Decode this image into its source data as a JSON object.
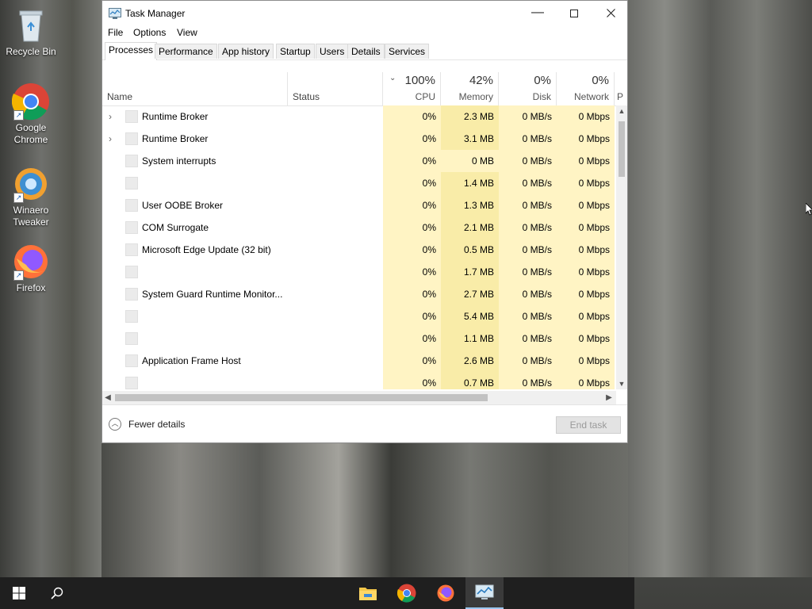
{
  "desktop": {
    "icons": [
      {
        "label": "Recycle Bin",
        "icon": "recycle-bin-icon"
      },
      {
        "label": "Google Chrome",
        "icon": "chrome-icon"
      },
      {
        "label": "Winaero Tweaker",
        "icon": "winaero-tweaker-icon"
      },
      {
        "label": "Firefox",
        "icon": "firefox-icon"
      }
    ]
  },
  "window": {
    "title": "Task Manager",
    "menu": [
      "File",
      "Options",
      "View"
    ],
    "tabs": [
      "Processes",
      "Performance",
      "App history",
      "Startup",
      "Users",
      "Details",
      "Services"
    ],
    "active_tab": "Processes",
    "columns": {
      "name": "Name",
      "status": "Status",
      "cpu": {
        "pct": "100%",
        "label": "CPU"
      },
      "memory": {
        "pct": "42%",
        "label": "Memory"
      },
      "disk": {
        "pct": "0%",
        "label": "Disk"
      },
      "network": {
        "pct": "0%",
        "label": "Network"
      },
      "power_partial": "P"
    },
    "rows": [
      {
        "name": "Runtime Broker",
        "expandable": true,
        "cpu": "0%",
        "memory": "2.3 MB",
        "disk": "0 MB/s",
        "network": "0 Mbps"
      },
      {
        "name": "Runtime Broker",
        "expandable": true,
        "cpu": "0%",
        "memory": "3.1 MB",
        "disk": "0 MB/s",
        "network": "0 Mbps"
      },
      {
        "name": "System interrupts",
        "expandable": false,
        "cpu": "0%",
        "memory": "0 MB",
        "disk": "0 MB/s",
        "network": "0 Mbps"
      },
      {
        "name": "",
        "expandable": false,
        "cpu": "0%",
        "memory": "1.4 MB",
        "disk": "0 MB/s",
        "network": "0 Mbps"
      },
      {
        "name": "User OOBE Broker",
        "expandable": false,
        "cpu": "0%",
        "memory": "1.3 MB",
        "disk": "0 MB/s",
        "network": "0 Mbps"
      },
      {
        "name": "COM Surrogate",
        "expandable": false,
        "cpu": "0%",
        "memory": "2.1 MB",
        "disk": "0 MB/s",
        "network": "0 Mbps"
      },
      {
        "name": "Microsoft Edge Update (32 bit)",
        "expandable": false,
        "cpu": "0%",
        "memory": "0.5 MB",
        "disk": "0 MB/s",
        "network": "0 Mbps"
      },
      {
        "name": "",
        "expandable": false,
        "cpu": "0%",
        "memory": "1.7 MB",
        "disk": "0 MB/s",
        "network": "0 Mbps"
      },
      {
        "name": "System Guard Runtime Monitor...",
        "expandable": false,
        "cpu": "0%",
        "memory": "2.7 MB",
        "disk": "0 MB/s",
        "network": "0 Mbps"
      },
      {
        "name": "",
        "expandable": false,
        "cpu": "0%",
        "memory": "5.4 MB",
        "disk": "0 MB/s",
        "network": "0 Mbps"
      },
      {
        "name": "",
        "expandable": false,
        "cpu": "0%",
        "memory": "1.1 MB",
        "disk": "0 MB/s",
        "network": "0 Mbps"
      },
      {
        "name": "Application Frame Host",
        "expandable": false,
        "cpu": "0%",
        "memory": "2.6 MB",
        "disk": "0 MB/s",
        "network": "0 Mbps"
      },
      {
        "name": "",
        "expandable": false,
        "cpu": "0%",
        "memory": "0.7 MB",
        "disk": "0 MB/s",
        "network": "0 Mbps"
      }
    ],
    "footer": {
      "fewer_details": "Fewer details",
      "end_task": "End task"
    }
  },
  "taskbar": {
    "items": [
      "start-icon",
      "search-icon",
      "file-explorer-icon",
      "chrome-icon",
      "firefox-icon",
      "task-manager-icon"
    ]
  },
  "colors": {
    "cpu_heat": "#fff4c4",
    "memory_heat": "#f9eca8",
    "memory_heat_light": "#fff4c4",
    "taskbar": "#1f1f1f"
  }
}
